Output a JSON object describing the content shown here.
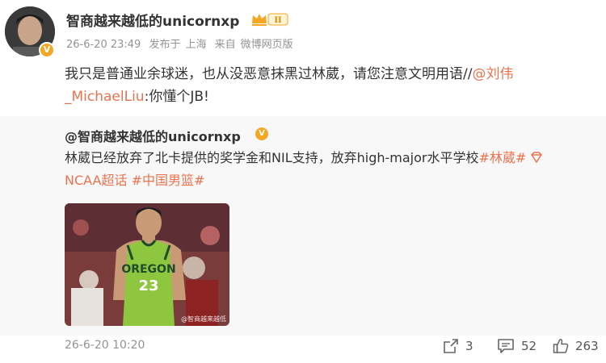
{
  "post": {
    "username": "智商越来越低的unicornxp",
    "level_badge": "II",
    "verified_badge": "V",
    "meta": {
      "time": "26-6-20 23:49",
      "publish_prefix": "发布于",
      "location": "上海",
      "source_prefix": "来自",
      "source": "微博网页版"
    },
    "text_before": "我只是普通业余球迷，也从没恶意抹黑过林葳，请您注意文明用语//",
    "mention": "@刘伟_MichaelLiu",
    "text_after": ":你懂个JB!"
  },
  "repost": {
    "username": "@智商越来越低的unicornxp",
    "verified_badge": "V",
    "text": "林葳已经放弃了北卡提供的奖学金和NIL支持，放弃high-major水平学校",
    "tag1": "#林葳#",
    "tag2": "NCAA超话",
    "tag3": "#中国男篮#",
    "image": {
      "jersey_text": "OREGON",
      "jersey_number": "23",
      "watermark": "@智商越来越低"
    }
  },
  "footer": {
    "date": "26-6-20 10:20",
    "repost_count": "3",
    "comment_count": "52",
    "like_count": "263"
  },
  "colors": {
    "accent": "#eb7350",
    "muted": "#939393",
    "repost_bg": "#f8f8f8"
  }
}
